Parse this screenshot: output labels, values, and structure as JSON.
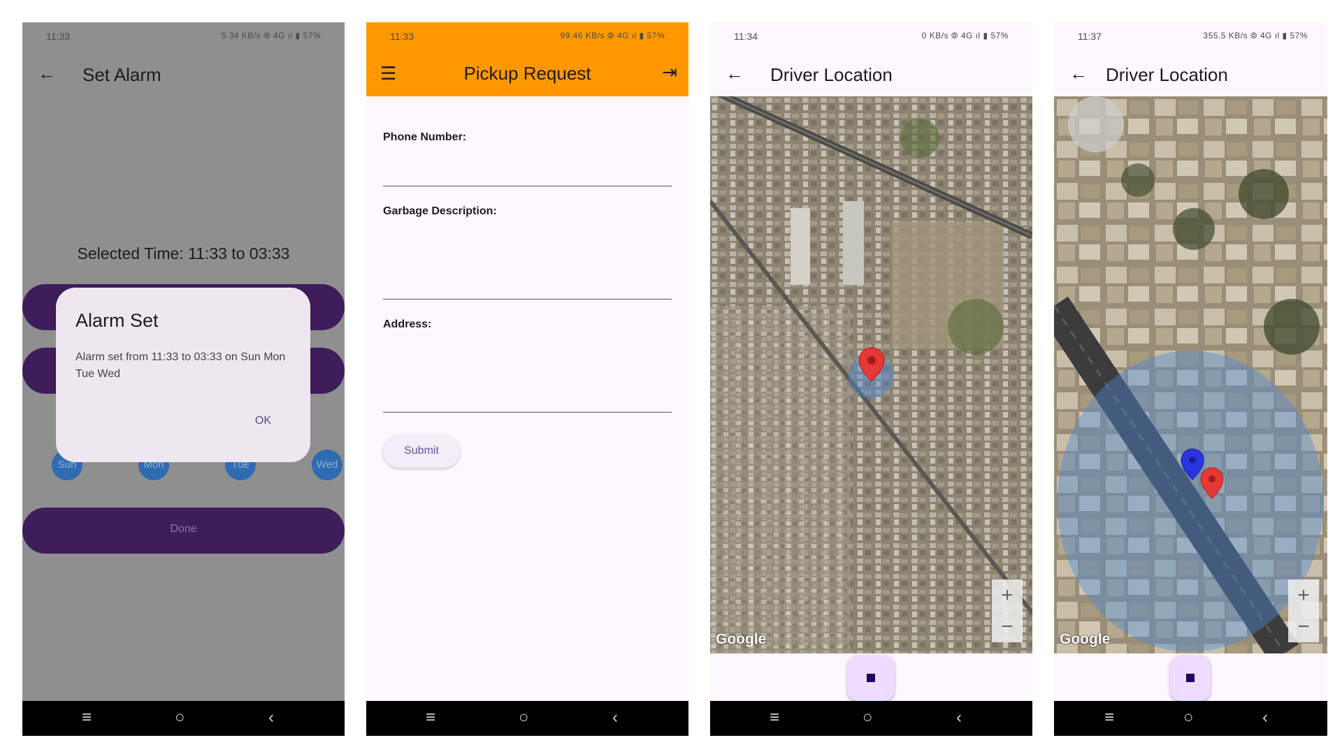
{
  "screen1": {
    "status": {
      "time": "11:33",
      "icons": "5.34 KB/s ⦾ 4G ıl ▮ 57%"
    },
    "appbar": {
      "back_icon": "arrow-back-icon",
      "title": "Set Alarm"
    },
    "selected_time": "Selected Time: 11:33 to 03:33",
    "days": [
      "Sun",
      "Mon",
      "Tue",
      "Wed"
    ],
    "done_label": "Done",
    "dialog": {
      "title": "Alarm Set",
      "message": "Alarm set from 11:33 to 03:33 on Sun Mon Tue Wed",
      "ok_label": "OK"
    }
  },
  "screen2": {
    "status": {
      "time": "11:33",
      "icons": "99.46 KB/s ⦾ 4G ıl ▮ 57%"
    },
    "appbar": {
      "menu_icon": "menu-icon",
      "title": "Pickup Request",
      "logout_icon": "logout-icon"
    },
    "fields": {
      "phone_label": "Phone Number:",
      "description_label": "Garbage Description:",
      "address_label": "Address:"
    },
    "submit_label": "Submit"
  },
  "screen3": {
    "status": {
      "time": "11:34",
      "icons": "0 KB/s ⦾ 4G ıl ▮ 57%"
    },
    "appbar": {
      "title": "Driver Location"
    },
    "map": {
      "attribution": "Google",
      "zoom_in": "+",
      "zoom_out": "−"
    }
  },
  "screen4": {
    "status": {
      "time": "11:37",
      "icons": "355.5 KB/s ⦾ 4G ıl ▮ 57%"
    },
    "appbar": {
      "title": "Driver Location"
    },
    "map": {
      "attribution": "Google",
      "zoom_in": "+",
      "zoom_out": "−"
    }
  },
  "navbar": {
    "recent_icon": "≡",
    "home_icon": "○",
    "back_icon": "‹"
  },
  "colors": {
    "accent_orange": "#ff9800",
    "dark_purple": "#3e1d5a",
    "day_blue": "#2f6bb0",
    "marker_red": "#e53935",
    "marker_blue": "#2a35e0"
  }
}
